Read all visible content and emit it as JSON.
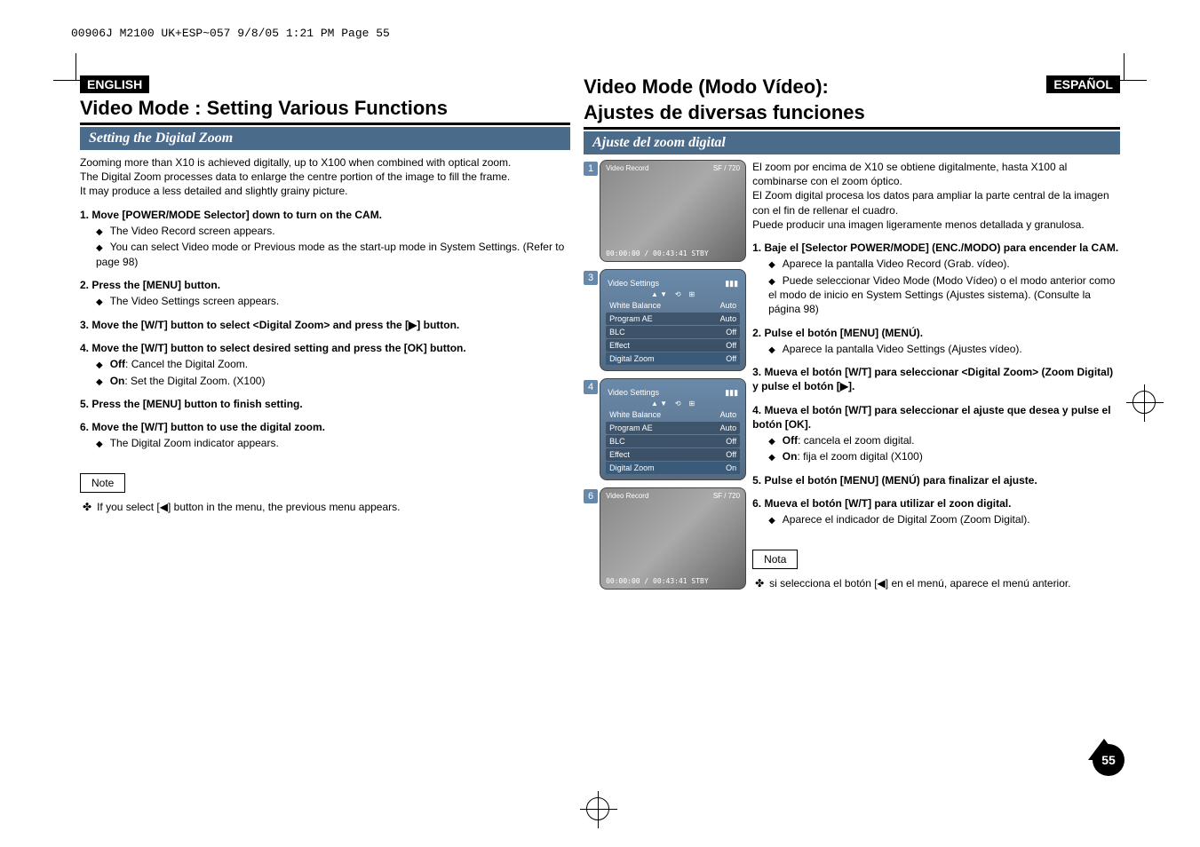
{
  "file_info": "00906J M2100 UK+ESP~057  9/8/05 1:21 PM  Page 55",
  "left": {
    "lang_badge": "ENGLISH",
    "main_title": "Video Mode : Setting Various Functions",
    "section_title": "Setting the Digital Zoom",
    "intro_p1": "Zooming more than X10 is achieved digitally, up to X100 when combined with optical zoom.",
    "intro_p2": "The Digital Zoom processes data to enlarge the centre portion of the image to fill the frame.",
    "intro_p3": "It may produce a less detailed and slightly grainy picture.",
    "steps": [
      {
        "num": "1.",
        "title": "Move [POWER/MODE Selector] down to turn on the CAM.",
        "bullets": [
          "The Video Record screen appears.",
          "You can select Video mode or Previous mode as the start-up mode in System Settings. (Refer to page 98)"
        ]
      },
      {
        "num": "2.",
        "title": "Press the [MENU] button.",
        "bullets": [
          "The Video Settings screen appears."
        ]
      },
      {
        "num": "3.",
        "title": "Move the [W/T] button to select <Digital Zoom> and press the [▶] button.",
        "bullets": []
      },
      {
        "num": "4.",
        "title": "Move the [W/T] button to select desired setting and press the [OK] button.",
        "bullets": [
          "Off: Cancel the Digital Zoom.",
          "On: Set the Digital Zoom. (X100)"
        ],
        "bullet_bold": [
          "Off",
          "On"
        ]
      },
      {
        "num": "5.",
        "title": "Press the [MENU] button to finish setting.",
        "bullets": []
      },
      {
        "num": "6.",
        "title": "Move the [W/T] button to use the digital zoom.",
        "bullets": [
          "The Digital Zoom indicator appears."
        ]
      }
    ],
    "note_label": "Note",
    "note_text": "If you select [◀] button in the menu, the previous menu appears."
  },
  "right": {
    "lang_badge": "ESPAÑOL",
    "main_title_l1": "Video Mode (Modo Vídeo):",
    "main_title_l2": "Ajustes de diversas funciones",
    "section_title": "Ajuste del zoom digital",
    "intro_p1": "El zoom por encima de X10 se obtiene digitalmente, hasta X100 al combinarse con el zoom óptico.",
    "intro_p2": "El Zoom digital procesa los datos para ampliar la parte central de la imagen con el fin de rellenar el cuadro.",
    "intro_p3": "Puede producir una imagen ligeramente menos detallada y granulosa.",
    "steps": [
      {
        "num": "1.",
        "title": "Baje el [Selector POWER/MODE] (ENC./MODO) para encender la CAM.",
        "bullets": [
          "Aparece la pantalla Video Record (Grab. vídeo).",
          "Puede seleccionar Video Mode (Modo Vídeo) o el modo anterior como el modo de inicio en System Settings (Ajustes sistema). (Consulte la página 98)"
        ]
      },
      {
        "num": "2.",
        "title": "Pulse el botón [MENU] (MENÚ).",
        "bullets": [
          "Aparece la pantalla Video Settings (Ajustes vídeo)."
        ]
      },
      {
        "num": "3.",
        "title": "Mueva el botón [W/T] para seleccionar <Digital Zoom> (Zoom Digital) y pulse el botón [▶].",
        "bullets": []
      },
      {
        "num": "4.",
        "title": "Mueva el botón [W/T] para seleccionar el ajuste que desea y pulse el botón [OK].",
        "bullets": [
          "Off: cancela el zoom digital.",
          "On: fija el zoom digital (X100)"
        ],
        "bullet_bold": [
          "Off",
          "On"
        ]
      },
      {
        "num": "5.",
        "title": "Pulse el botón [MENU] (MENÚ) para finalizar el ajuste.",
        "bullets": []
      },
      {
        "num": "6.",
        "title": "Mueva el botón [W/T] para utilizar el zoon digital.",
        "bullets": [
          "Aparece el indicador de Digital Zoom (Zoom Digital)."
        ]
      }
    ],
    "note_label": "Nota",
    "note_text": "si selecciona el botón [◀] en el menú, aparece el menú anterior."
  },
  "screenshots": {
    "s1_num": "1",
    "s1_top": "Video Record",
    "s1_bottom": "00:00:00 / 00:43:41  STBY",
    "s1_quality": "SF / 720",
    "s3_num": "3",
    "s3_header": "Video Settings",
    "s3_rows": [
      {
        "label": "White Balance",
        "value": "Auto"
      },
      {
        "label": "Program AE",
        "value": "Auto"
      },
      {
        "label": "BLC",
        "value": "Off"
      },
      {
        "label": "Effect",
        "value": "Off"
      },
      {
        "label": "Digital Zoom",
        "value": "Off"
      }
    ],
    "s4_num": "4",
    "s4_header": "Video Settings",
    "s4_rows": [
      {
        "label": "White Balance",
        "value": "Auto"
      },
      {
        "label": "Program AE",
        "value": "Auto"
      },
      {
        "label": "BLC",
        "value": "Off"
      },
      {
        "label": "Effect",
        "value": "Off"
      },
      {
        "label": "Digital Zoom",
        "value": "On"
      }
    ],
    "s6_num": "6",
    "s6_top": "Video Record",
    "s6_bottom": "00:00:00 / 00:43:41  STBY",
    "s6_quality": "SF / 720"
  },
  "page_number": "55"
}
